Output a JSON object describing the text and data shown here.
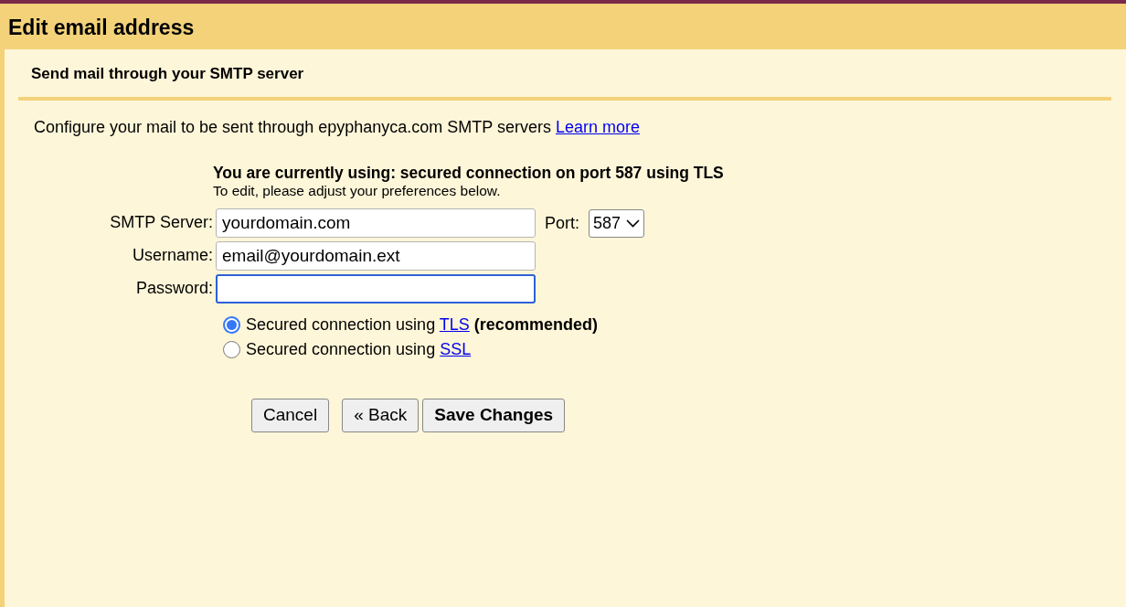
{
  "window": {
    "title": "Edit email address"
  },
  "section": {
    "title": "Send mail through your SMTP server"
  },
  "intro": {
    "text": "Configure your mail to be sent through epyphanyca.com SMTP servers ",
    "link": "Learn more"
  },
  "status": {
    "headline": "You are currently using: secured connection on port 587 using TLS",
    "hint": "To edit, please adjust your preferences below."
  },
  "fields": [
    {
      "label": "SMTP Server:",
      "value": "yourdomain.com",
      "focused": false,
      "port": {
        "label": "Port:",
        "value": "587"
      }
    },
    {
      "label": "Username:",
      "value": "email@yourdomain.ext",
      "focused": false
    },
    {
      "label": "Password:",
      "focused": true
    }
  ],
  "security": [
    {
      "text": "Secured connection using ",
      "link": "TLS",
      "note": "(recommended)",
      "selected": true
    },
    {
      "text": "Secured connection using ",
      "link": "SSL",
      "selected": false
    }
  ],
  "buttons": [
    {
      "label": "Cancel",
      "primary": false
    },
    {
      "label": "« Back",
      "primary": false
    },
    {
      "label": "Save Changes",
      "primary": true
    }
  ]
}
